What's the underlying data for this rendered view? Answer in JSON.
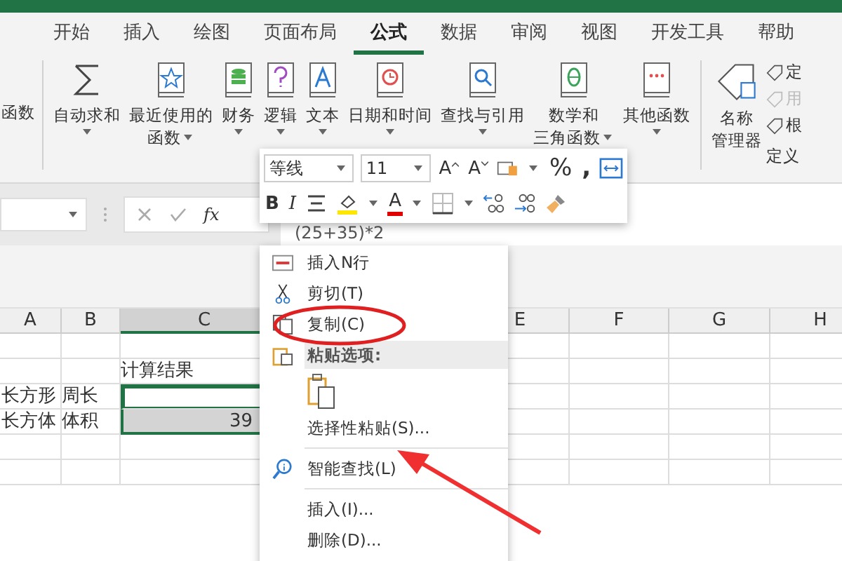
{
  "tabs": [
    {
      "label": "开始",
      "selected": false
    },
    {
      "label": "插入",
      "selected": false
    },
    {
      "label": "绘图",
      "selected": false
    },
    {
      "label": "页面布局",
      "selected": false
    },
    {
      "label": "公式",
      "selected": true
    },
    {
      "label": "数据",
      "selected": false
    },
    {
      "label": "审阅",
      "selected": false
    },
    {
      "label": "视图",
      "selected": false
    },
    {
      "label": "开发工具",
      "selected": false
    },
    {
      "label": "帮助",
      "selected": false
    }
  ],
  "ribbon": {
    "cut_label": "函数",
    "items": [
      {
        "lines": [
          "自动求和"
        ],
        "dropdown": true
      },
      {
        "lines": [
          "最近使用的",
          "函数"
        ],
        "dropdown": true
      },
      {
        "lines": [
          "财务"
        ],
        "dropdown": true
      },
      {
        "lines": [
          "逻辑"
        ],
        "dropdown": true
      },
      {
        "lines": [
          "文本"
        ],
        "dropdown": true
      },
      {
        "lines": [
          "日期和时间"
        ],
        "dropdown": true
      },
      {
        "lines": [
          "查找与引用"
        ],
        "dropdown": true
      },
      {
        "lines": [
          "数学和",
          "三角函数"
        ],
        "dropdown": true
      },
      {
        "lines": [
          "其他函数"
        ],
        "dropdown": true
      }
    ],
    "name_manager": [
      "名称",
      "管理器"
    ],
    "small_items": [
      {
        "label": "定",
        "disabled": false
      },
      {
        "label": "用",
        "disabled": true
      },
      {
        "label": "根",
        "disabled": false
      }
    ],
    "group_label": "定义"
  },
  "formula_bar": {
    "fx": "fx",
    "formula": "(25+35)*2"
  },
  "mini_toolbar": {
    "font": "等线",
    "size": "11",
    "grow": "A",
    "shrink": "A",
    "percent": "%",
    "comma": ",",
    "bold": "B",
    "italic": "I",
    "font_color": "A"
  },
  "sheet": {
    "columns": [
      {
        "label": "A",
        "selected": false
      },
      {
        "label": "B",
        "selected": false
      },
      {
        "label": "C",
        "selected": true
      },
      {
        "label": "E",
        "selected": false
      },
      {
        "label": "F",
        "selected": false
      },
      {
        "label": "G",
        "selected": false
      },
      {
        "label": "H",
        "selected": false
      }
    ],
    "rows": [
      {
        "cells": [
          null,
          null,
          null
        ],
        "selected": false,
        "active": false
      },
      {
        "cells": [
          null,
          null,
          "计算结果"
        ],
        "selected": false,
        "active": false
      },
      {
        "cells": [
          "长方形",
          "周长",
          null
        ],
        "selected": true,
        "active": true
      },
      {
        "cells": [
          "长方体",
          "体积",
          "39"
        ],
        "selected": true,
        "active": false
      },
      {
        "cells": [
          null,
          null,
          null
        ],
        "selected": false,
        "active": false
      },
      {
        "cells": [
          null,
          null,
          null
        ],
        "selected": false,
        "active": false
      }
    ]
  },
  "context_menu": [
    {
      "kind": "item",
      "label": "插入N行"
    },
    {
      "kind": "item",
      "label": "剪切(T)"
    },
    {
      "kind": "item",
      "label": "复制(C)"
    },
    {
      "kind": "header",
      "label": "粘贴选项:"
    },
    {
      "kind": "paste-icons"
    },
    {
      "kind": "item",
      "label": "选择性粘贴(S)..."
    },
    {
      "kind": "separator"
    },
    {
      "kind": "item",
      "label": "智能查找(L)"
    },
    {
      "kind": "separator"
    },
    {
      "kind": "item",
      "label": "插入(I)..."
    },
    {
      "kind": "item",
      "label": "删除(D)..."
    }
  ]
}
